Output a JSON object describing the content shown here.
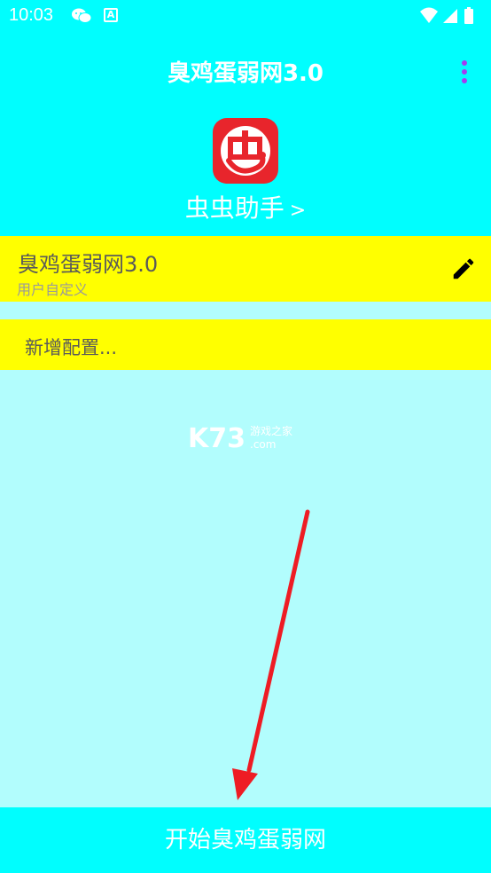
{
  "status_bar": {
    "time": "10:03",
    "icons": [
      "wechat-icon",
      "a-notification-icon",
      "wifi-icon",
      "signal-icon",
      "battery-icon"
    ]
  },
  "header": {
    "title": "臭鸡蛋弱网3.0",
    "menu_icon": "more-vertical-icon",
    "logo_glyph": "虫",
    "assistant_label": "虫虫助手",
    "assistant_chevron": ">"
  },
  "config_card": {
    "title": "臭鸡蛋弱网3.0",
    "subtitle": "用户自定义",
    "edit_icon": "pencil-icon"
  },
  "add_config": {
    "label": "新增配置..."
  },
  "watermark": {
    "brand": "K73",
    "cn": "游戏之家",
    "domain": ".com"
  },
  "start_button": {
    "label": "开始臭鸡蛋弱网"
  },
  "colors": {
    "cyan": "#00fefe",
    "light_cyan": "#b2fdfd",
    "yellow": "#ffff00",
    "menu_purple": "#a53cf0",
    "logo_red": "#e8252c",
    "arrow_red": "#ee1c24"
  }
}
